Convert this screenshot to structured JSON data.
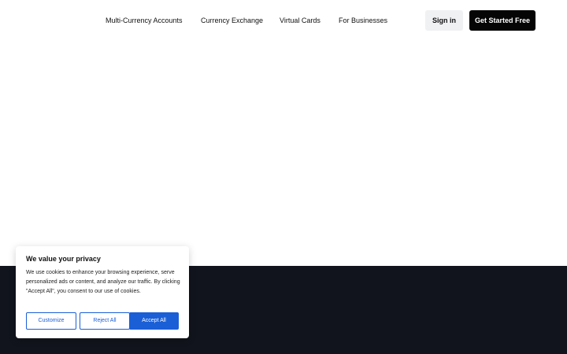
{
  "nav": {
    "links": [
      "Multi-Currency Accounts",
      "Currency Exchange",
      "Virtual Cards",
      "For Businesses"
    ],
    "sign_in_label": "Sign in",
    "get_started_label": "Get Started Free"
  },
  "cookie_banner": {
    "title": "We value your privacy",
    "description": "We use cookies to enhance your browsing experience, serve personalized ads or content, and analyze our traffic. By clicking \"Accept All\", you consent to our use of cookies.",
    "customize_label": "Customize",
    "reject_label": "Reject All",
    "accept_label": "Accept All"
  },
  "colors": {
    "primary_button": "#050505",
    "secondary_button": "#f0f1f3",
    "dark_section": "#11141c",
    "cookie_accent": "#1a5fd6"
  }
}
